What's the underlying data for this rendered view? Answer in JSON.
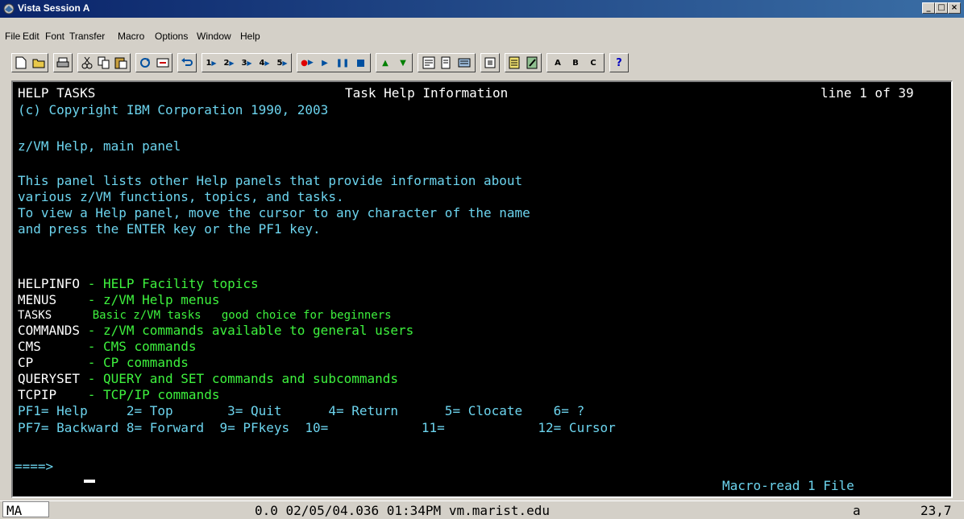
{
  "window": {
    "title": "Vista Session A",
    "minimize_label": "_",
    "maximize_label": "□",
    "close_label": "×"
  },
  "menu": {
    "items": [
      "File",
      "Edit",
      "Font",
      "Transfer",
      "Macro",
      "Options",
      "Window",
      "Help"
    ]
  },
  "toolbar": {
    "macro_buttons": [
      "1",
      "2",
      "3",
      "4",
      "5"
    ],
    "letter_buttons": [
      "A",
      "B",
      "C"
    ],
    "help_button": "?"
  },
  "screen": {
    "header_left": "HELP TASKS",
    "header_center": "Task Help Information",
    "header_right": "line 1 of 39",
    "copyright": "(c) Copyright IBM Corporation 1990, 2003",
    "panel_title": "z/VM Help, main panel",
    "intro_lines": [
      "This panel lists other Help panels that provide information about",
      "various z/VM functions, topics, and tasks.",
      "To view a Help panel, move the cursor to any character of the name",
      "and press the ENTER key or the PF1 key."
    ],
    "entries": [
      {
        "name": "HELPINFO",
        "desc": " - HELP Facility topics"
      },
      {
        "name": "MENUS",
        "desc": "    - z/VM Help menus"
      },
      {
        "name": "TASKS",
        "desc": "      Basic z/VM tasks   good choice for beginners"
      },
      {
        "name": "COMMANDS",
        "desc": " - z/VM commands available to general users"
      },
      {
        "name": "CMS",
        "desc": "      - CMS commands"
      },
      {
        "name": "CP",
        "desc": "       - CP commands"
      },
      {
        "name": "QUERYSET",
        "desc": " - QUERY and SET commands and subcommands"
      },
      {
        "name": "TCPIP",
        "desc": "    - TCP/IP commands"
      }
    ],
    "pf_row1": "PF1= Help     2= Top       3= Quit      4= Return      5= Clocate    6= ?",
    "pf_row2": "PF7= Backward 8= Forward  9= PFkeys  10=            11=            12= Cursor",
    "command_prompt": "====>",
    "status_message": "Macro-read 1 File"
  },
  "statusbar": {
    "mode": "MA",
    "info": "0.0 02/05/04.036 01:34PM vm.marist.edu",
    "session": "a",
    "cursor_pos": "23,7"
  }
}
